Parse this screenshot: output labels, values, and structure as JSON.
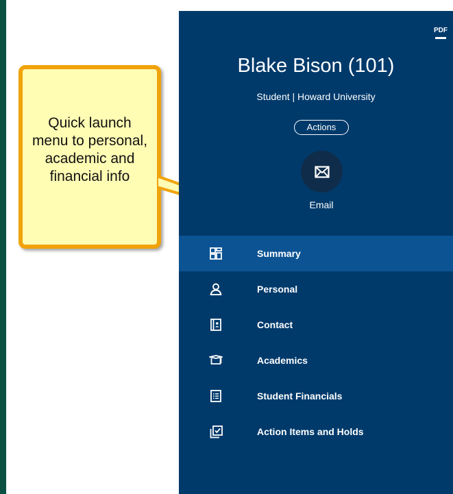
{
  "callout": {
    "text": "Quick launch menu to personal, academic and financial info"
  },
  "profile": {
    "name": "Blake Bison (101)",
    "subtitle": "Student | Howard University",
    "actions_label": "Actions",
    "email_label": "Email",
    "pdf_label": "PDF"
  },
  "menu": {
    "items": [
      {
        "label": "Summary",
        "icon": "grid-icon",
        "active": true
      },
      {
        "label": "Personal",
        "icon": "person-icon",
        "active": false
      },
      {
        "label": "Contact",
        "icon": "contact-book-icon",
        "active": false
      },
      {
        "label": "Academics",
        "icon": "graduation-cap-icon",
        "active": false
      },
      {
        "label": "Student Financials",
        "icon": "list-document-icon",
        "active": false
      },
      {
        "label": "Action Items and Holds",
        "icon": "checklist-icon",
        "active": false
      }
    ]
  },
  "colors": {
    "frame": "#0a5143",
    "panel": "#003a6b",
    "active_item": "#0b5393",
    "callout_border": "#f0a30a",
    "callout_fill": "#fffcb4"
  }
}
